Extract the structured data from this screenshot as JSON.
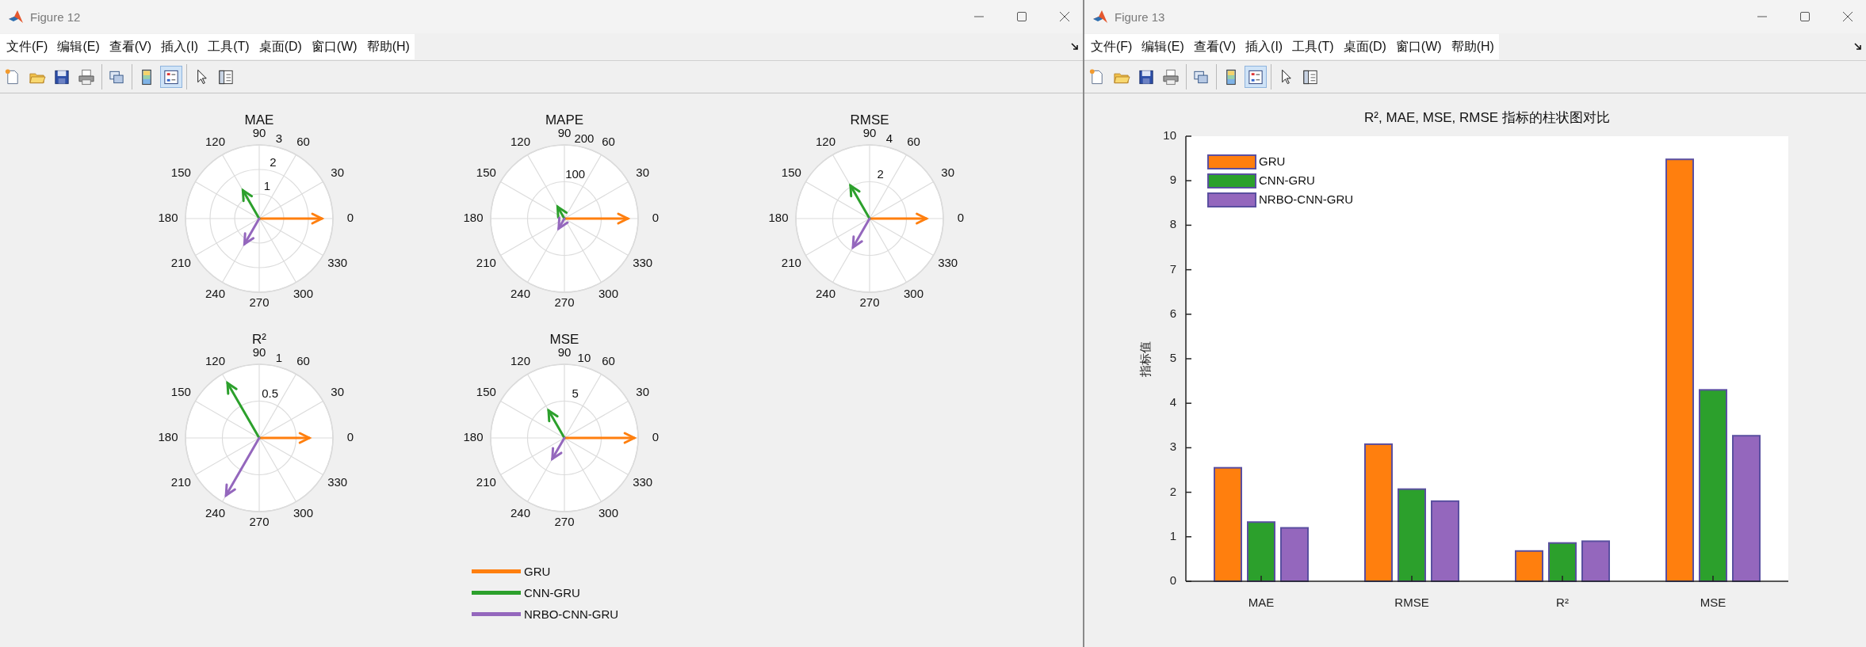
{
  "windows": [
    {
      "title": "Figure 12",
      "menu": [
        {
          "label": "文件(F)"
        },
        {
          "label": "编辑(E)"
        },
        {
          "label": "查看(V)"
        },
        {
          "label": "插入(I)"
        },
        {
          "label": "工具(T)"
        },
        {
          "label": "桌面(D)"
        },
        {
          "label": "窗口(W)"
        },
        {
          "label": "帮助(H)"
        }
      ],
      "toolbar": [
        {
          "items": [
            {
              "kind": "new",
              "selected": false
            },
            {
              "kind": "open",
              "selected": false
            },
            {
              "kind": "save",
              "selected": false
            },
            {
              "kind": "print",
              "selected": false
            }
          ]
        },
        {
          "items": [
            {
              "kind": "link",
              "selected": false
            }
          ]
        },
        {
          "items": [
            {
              "kind": "colorbar",
              "selected": false
            },
            {
              "kind": "legend",
              "selected": true
            }
          ]
        },
        {
          "items": [
            {
              "kind": "pointer",
              "selected": false
            },
            {
              "kind": "inspector",
              "selected": false
            }
          ]
        }
      ],
      "figure": {
        "kind": "polar",
        "plots": [
          {
            "title": "MAE",
            "angle_labels": [
              "0",
              "30",
              "60",
              "90",
              "120",
              "150",
              "180",
              "210",
              "240",
              "270",
              "300",
              "330"
            ],
            "radius_labels": [
              "1",
              "2",
              "3"
            ]
          },
          {
            "title": "MAPE",
            "angle_labels": [
              "0",
              "30",
              "60",
              "90",
              "120",
              "150",
              "180",
              "210",
              "240",
              "270",
              "300",
              "330"
            ],
            "radius_labels": [
              "100",
              "200"
            ]
          },
          {
            "title": "RMSE",
            "angle_labels": [
              "0",
              "30",
              "60",
              "90",
              "120",
              "150",
              "180",
              "210",
              "240",
              "270",
              "300",
              "330"
            ],
            "radius_labels": [
              "2",
              "4"
            ]
          },
          {
            "title": "R²",
            "angle_labels": [
              "0",
              "30",
              "60",
              "90",
              "120",
              "150",
              "180",
              "210",
              "240",
              "270",
              "300",
              "330"
            ],
            "radius_labels": [
              "0.5",
              "1"
            ]
          },
          {
            "title": "MSE",
            "angle_labels": [
              "0",
              "30",
              "60",
              "90",
              "120",
              "150",
              "180",
              "210",
              "240",
              "270",
              "300",
              "330"
            ],
            "radius_labels": [
              "5",
              "10"
            ]
          }
        ],
        "legend": [
          {
            "name": "GRU",
            "color": "#ff7f0e"
          },
          {
            "name": "CNN-GRU",
            "color": "#2ca02c"
          },
          {
            "name": "NRBO-CNN-GRU",
            "color": "#9467bd"
          }
        ]
      }
    },
    {
      "title": "Figure 13",
      "menu": [
        {
          "label": "文件(F)"
        },
        {
          "label": "编辑(E)"
        },
        {
          "label": "查看(V)"
        },
        {
          "label": "插入(I)"
        },
        {
          "label": "工具(T)"
        },
        {
          "label": "桌面(D)"
        },
        {
          "label": "窗口(W)"
        },
        {
          "label": "帮助(H)"
        }
      ],
      "toolbar": [
        {
          "items": [
            {
              "kind": "new",
              "selected": false
            },
            {
              "kind": "open",
              "selected": false
            },
            {
              "kind": "save",
              "selected": false
            },
            {
              "kind": "print",
              "selected": false
            }
          ]
        },
        {
          "items": [
            {
              "kind": "link",
              "selected": false
            }
          ]
        },
        {
          "items": [
            {
              "kind": "colorbar",
              "selected": false
            },
            {
              "kind": "legend",
              "selected": true
            }
          ]
        },
        {
          "items": [
            {
              "kind": "pointer",
              "selected": false
            },
            {
              "kind": "inspector",
              "selected": false
            }
          ]
        }
      ],
      "figure": {
        "kind": "bar",
        "chart_data": {
          "type": "bar",
          "title": "R², MAE, MSE, RMSE 指标的柱状图对比",
          "ylabel": "指标值",
          "categories": [
            "MAE",
            "RMSE",
            "R²",
            "MSE"
          ],
          "ylim": [
            0,
            10
          ],
          "yticks": [
            0,
            1,
            2,
            3,
            4,
            5,
            6,
            7,
            8,
            9,
            10
          ],
          "legend": "upper left",
          "series": [
            {
              "name": "GRU",
              "color": "#ff7f0e",
              "values": [
                2.55,
                3.08,
                0.68,
                9.48
              ]
            },
            {
              "name": "CNN-GRU",
              "color": "#2ca02c",
              "values": [
                1.33,
                2.07,
                0.86,
                4.3
              ]
            },
            {
              "name": "NRBO-CNN-GRU",
              "color": "#9467bd",
              "values": [
                1.2,
                1.8,
                0.9,
                3.27
              ]
            }
          ]
        }
      }
    }
  ]
}
